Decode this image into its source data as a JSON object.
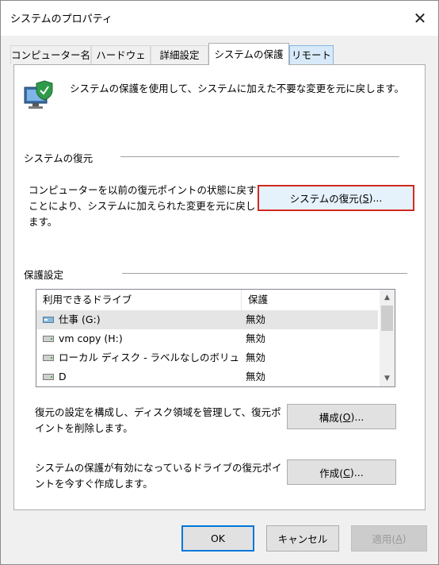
{
  "window": {
    "title": "システムのプロパティ",
    "close_glyph": "✕"
  },
  "tabs": [
    {
      "label": "コンピューター名",
      "active": false
    },
    {
      "label": "ハードウェア",
      "active": false
    },
    {
      "label": "詳細設定",
      "active": false
    },
    {
      "label": "システムの保護",
      "active": true
    },
    {
      "label": "リモート",
      "active": false
    }
  ],
  "intro": {
    "icon": "system-protection-icon",
    "text": "システムの保護を使用して、システムに加えた不要な変更を元に戻します。"
  },
  "restore_section": {
    "title": "システムの復元",
    "description": "コンピューターを以前の復元ポイントの状態に戻すことにより、システムに加えられた変更を元に戻します。",
    "button_prefix": "システムの復元(",
    "button_key": "S",
    "button_suffix": ")..."
  },
  "protection_section": {
    "title": "保護設定",
    "columns": [
      "利用できるドライブ",
      "保護"
    ],
    "drives": [
      {
        "name": "仕事 (G:)",
        "status": "無効",
        "icon": "usb-drive-icon",
        "selected": true
      },
      {
        "name": "vm copy (H:)",
        "status": "無効",
        "icon": "disk-drive-icon",
        "selected": false
      },
      {
        "name": "ローカル ディスク - ラベルなしのボリュー...",
        "status": "無効",
        "icon": "disk-drive-icon",
        "selected": false
      },
      {
        "name": "D",
        "status": "無効",
        "icon": "disk-drive-icon",
        "selected": false
      }
    ],
    "configure": {
      "description": "復元の設定を構成し、ディスク領域を管理して、復元ポイントを削除します。",
      "button_prefix": "構成(",
      "button_key": "O",
      "button_suffix": ")..."
    },
    "create": {
      "description": "システムの保護が有効になっているドライブの復元ポイントを今すぐ作成します。",
      "button_prefix": "作成(",
      "button_key": "C",
      "button_suffix": ")..."
    }
  },
  "footer": {
    "ok": "OK",
    "cancel": "キャンセル",
    "apply_prefix": "適用(",
    "apply_key": "A",
    "apply_suffix": ")"
  },
  "colors": {
    "highlight_border": "#d12a1f",
    "default_button_border": "#0078d7"
  }
}
